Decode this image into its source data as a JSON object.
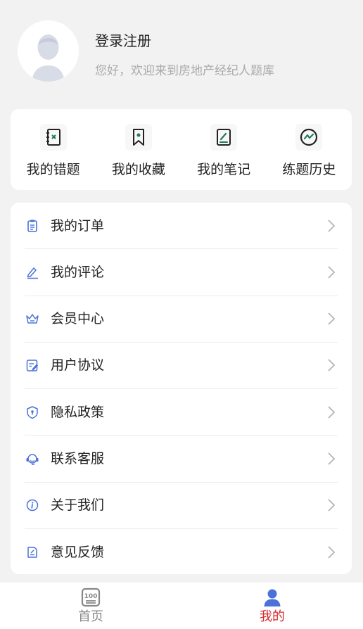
{
  "profile": {
    "title": "登录注册",
    "welcome": "您好，欢迎来到房地产经纪人题库"
  },
  "quick": {
    "items": [
      {
        "label": "我的错题",
        "icon": "wrong-questions-icon"
      },
      {
        "label": "我的收藏",
        "icon": "bookmark-icon"
      },
      {
        "label": "我的笔记",
        "icon": "notes-icon"
      },
      {
        "label": "练题历史",
        "icon": "history-chart-icon"
      }
    ]
  },
  "menu": {
    "items": [
      {
        "label": "我的订单",
        "icon": "clipboard-icon"
      },
      {
        "label": "我的评论",
        "icon": "edit-icon"
      },
      {
        "label": "会员中心",
        "icon": "crown-icon"
      },
      {
        "label": "用户协议",
        "icon": "document-edit-icon"
      },
      {
        "label": "隐私政策",
        "icon": "shield-icon"
      },
      {
        "label": "联系客服",
        "icon": "headset-icon"
      },
      {
        "label": "关于我们",
        "icon": "info-icon"
      },
      {
        "label": "意见反馈",
        "icon": "feedback-icon"
      }
    ]
  },
  "tabbar": {
    "home_label": "首页",
    "mine_label": "我的",
    "home_icon_text": "100"
  },
  "colors": {
    "accent_blue": "#4a72d9",
    "accent_red": "#d8262b",
    "quick_green": "#1f7a5a"
  }
}
